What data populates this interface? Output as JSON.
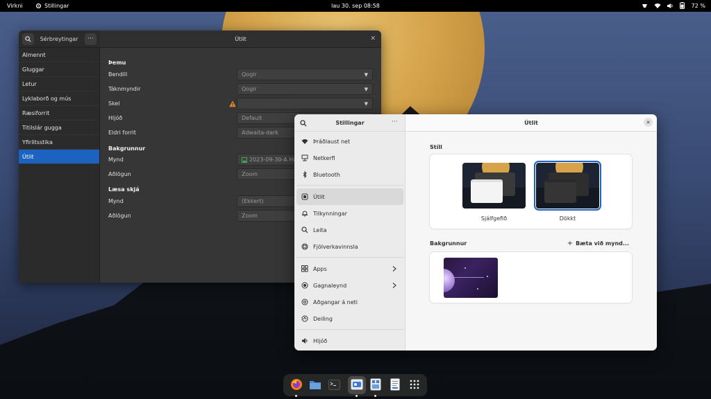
{
  "topbar": {
    "activities": "Virkni",
    "app_name": "Stillingar",
    "clock": "lau 30. sep  08:58",
    "battery": "72 %"
  },
  "tweaks_window": {
    "title": "Sérbreytingar",
    "page_title": "Útlit",
    "nav": [
      "Almennt",
      "Gluggar",
      "Letur",
      "Lyklaborð og mús",
      "Ræsiforrit",
      "Titilslár gugga",
      "Yfirlitsstika",
      "Útlit"
    ],
    "active_nav": "Útlit",
    "sections": {
      "themes": "Þemu",
      "background": "Bakgrunnur",
      "lockscreen": "Læsa skjá"
    },
    "rows": {
      "cursor_label": "Bendill",
      "cursor_value": "Qogir",
      "icons_label": "Táknmyndir",
      "icons_value": "Qogir",
      "shell_label": "Skel",
      "shell_value": "",
      "sound_label": "Hljóð",
      "sound_value": "Default",
      "legacy_label": "Eldri forrit",
      "legacy_value": "Adwaita-dark",
      "bg_image_label": "Mynd",
      "bg_image_value": "2023-09-30-A Har",
      "bg_adjust_label": "Aðlögun",
      "bg_adjust_value": "Zoom",
      "lock_image_label": "Mynd",
      "lock_image_value": "(Ekkert)",
      "lock_adjust_label": "Aðlögun",
      "lock_adjust_value": "Zoom"
    }
  },
  "settings_window": {
    "title": "Stillingar",
    "page_title": "Útlit",
    "nav": [
      {
        "label": "Þráðlaust net",
        "icon": "wifi-icon"
      },
      {
        "label": "Netkerfi",
        "icon": "network-icon"
      },
      {
        "label": "Bluetooth",
        "icon": "bluetooth-icon"
      },
      {
        "label": "Útlit",
        "icon": "appearance-icon"
      },
      {
        "label": "Tilkynningar",
        "icon": "bell-icon"
      },
      {
        "label": "Leita",
        "icon": "search-icon"
      },
      {
        "label": "Fjölverkavinnsla",
        "icon": "multitasking-icon"
      },
      {
        "label": "Apps",
        "icon": "apps-icon"
      },
      {
        "label": "Gagnaleynd",
        "icon": "privacy-icon"
      },
      {
        "label": "Aðgangar á neti",
        "icon": "online-accounts-icon"
      },
      {
        "label": "Deiling",
        "icon": "sharing-icon"
      },
      {
        "label": "Hljóð",
        "icon": "sound-icon"
      }
    ],
    "active_nav": "Útlit",
    "style_heading": "Stíll",
    "style_default": "Sjálfgefið",
    "style_dark": "Dökkt",
    "selected_style": "Dökkt",
    "background_heading": "Bakgrunnur",
    "add_picture": "Bæta við mynd..."
  },
  "colors": {
    "accent": "#1c62c0",
    "dark_window": "#353535",
    "light_window": "#fafafa"
  },
  "dock": [
    "firefox-icon",
    "files-icon",
    "terminal-icon",
    "settings-icon",
    "software-icon",
    "text-editor-icon",
    "app-grid-icon"
  ]
}
